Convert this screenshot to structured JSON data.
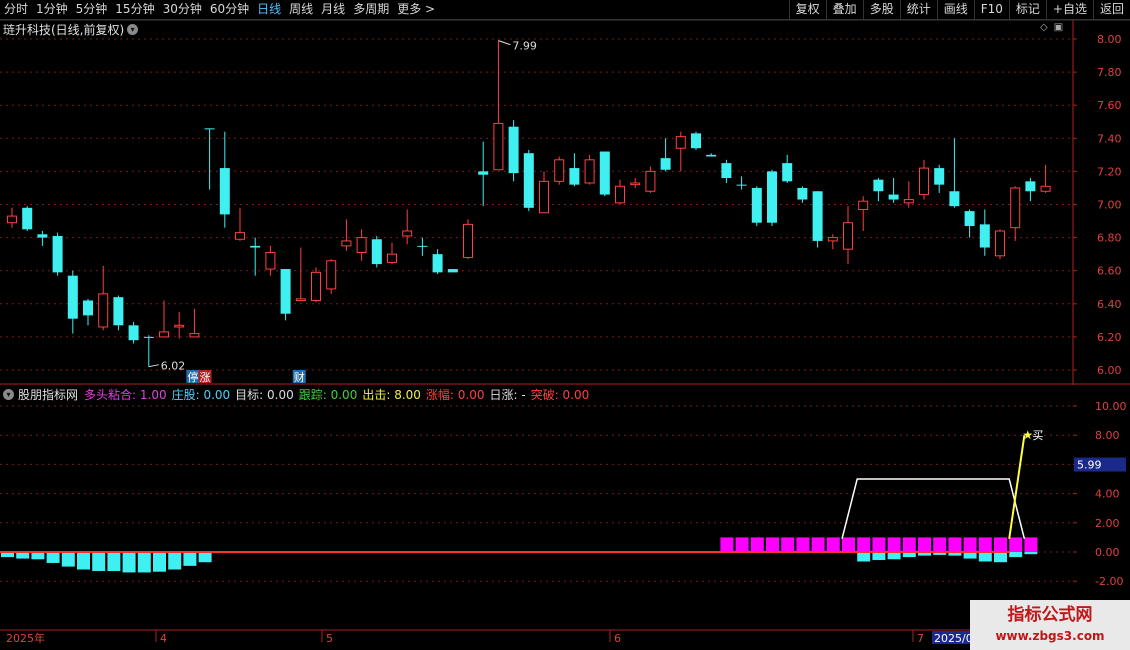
{
  "toolbar": {
    "periods": [
      "分时",
      "1分钟",
      "5分钟",
      "15分钟",
      "30分钟",
      "60分钟",
      "日线",
      "周线",
      "月线",
      "多周期",
      "更多 >"
    ],
    "active_period": "日线",
    "buttons": [
      "复权",
      "叠加",
      "多股",
      "统计",
      "画线",
      "F10",
      "标记",
      "+自选",
      "返回"
    ]
  },
  "main_panel": {
    "title": "琏升科技(日线,前复权)",
    "high_label": "7.99",
    "low_label": "6.02",
    "markers": [
      "停",
      "涨",
      "财"
    ],
    "y_ticks": [
      "8.00",
      "7.80",
      "7.60",
      "7.40",
      "7.20",
      "7.00",
      "6.80",
      "6.60",
      "6.40",
      "6.20",
      "6.00"
    ]
  },
  "indicator_panel": {
    "name": "股朋指标网",
    "items": [
      {
        "label": "多头粘合",
        "value": "1.00",
        "color": "#e040e0"
      },
      {
        "label": "庄股",
        "value": "0.00",
        "color": "#4fd0ff"
      },
      {
        "label": "目标",
        "value": "0.00",
        "color": "#dddddd"
      },
      {
        "label": "跟踪",
        "value": "0.00",
        "color": "#40d040"
      },
      {
        "label": "出击",
        "value": "8.00",
        "color": "#f0f040"
      },
      {
        "label": "涨幅",
        "value": "0.00",
        "color": "#ff4040"
      },
      {
        "label": "日涨",
        "value": "-",
        "color": "#dddddd"
      },
      {
        "label": "突破",
        "value": "0.00",
        "color": "#ff4040"
      }
    ],
    "y_ticks": [
      "10.00",
      "8.00",
      "6.00",
      "4.00",
      "2.00",
      "0.00",
      "-2.00"
    ],
    "current_value_box": "5.99",
    "buy_signal": "买"
  },
  "time_axis": {
    "labels": [
      "2025年",
      "4",
      "5",
      "6",
      "7",
      "2025/0"
    ]
  },
  "watermark": {
    "line1": "指标公式网",
    "line2": "www.zbgs3.com"
  },
  "colors": {
    "up": "#ff4040",
    "down": "#40f0f0",
    "grid": "#7a1a1a",
    "magenta": "#ff00ff",
    "yellow": "#ffff40"
  },
  "chart_data": {
    "type": "candlestick",
    "ylim": [
      5.95,
      8.05
    ],
    "high_label_value": 7.99,
    "low_label_value": 6.02,
    "candles": [
      {
        "o": 6.89,
        "c": 6.93,
        "h": 6.98,
        "l": 6.86
      },
      {
        "o": 6.98,
        "c": 6.85,
        "h": 6.99,
        "l": 6.84
      },
      {
        "o": 6.82,
        "c": 6.8,
        "h": 6.84,
        "l": 6.75
      },
      {
        "o": 6.81,
        "c": 6.59,
        "h": 6.83,
        "l": 6.57
      },
      {
        "o": 6.57,
        "c": 6.31,
        "h": 6.6,
        "l": 6.22
      },
      {
        "o": 6.42,
        "c": 6.33,
        "h": 6.43,
        "l": 6.27
      },
      {
        "o": 6.26,
        "c": 6.46,
        "h": 6.63,
        "l": 6.24
      },
      {
        "o": 6.44,
        "c": 6.27,
        "h": 6.45,
        "l": 6.24
      },
      {
        "o": 6.27,
        "c": 6.18,
        "h": 6.29,
        "l": 6.16
      },
      {
        "o": 6.2,
        "c": 6.2,
        "h": 6.21,
        "l": 6.02
      },
      {
        "o": 6.2,
        "c": 6.23,
        "h": 6.42,
        "l": 6.2
      },
      {
        "o": 6.26,
        "c": 6.27,
        "h": 6.35,
        "l": 6.19
      },
      {
        "o": 6.2,
        "c": 6.22,
        "h": 6.37,
        "l": 6.2
      },
      {
        "o": 7.46,
        "c": 7.46,
        "h": 7.46,
        "l": 7.09
      },
      {
        "o": 7.22,
        "c": 6.94,
        "h": 7.44,
        "l": 6.86
      },
      {
        "o": 6.79,
        "c": 6.83,
        "h": 6.98,
        "l": 6.78
      },
      {
        "o": 6.75,
        "c": 6.74,
        "h": 6.8,
        "l": 6.57
      },
      {
        "o": 6.61,
        "c": 6.71,
        "h": 6.75,
        "l": 6.57
      },
      {
        "o": 6.61,
        "c": 6.34,
        "h": 6.61,
        "l": 6.3
      },
      {
        "o": 6.42,
        "c": 6.43,
        "h": 6.74,
        "l": 6.42
      },
      {
        "o": 6.42,
        "c": 6.59,
        "h": 6.62,
        "l": 6.41
      },
      {
        "o": 6.49,
        "c": 6.66,
        "h": 6.67,
        "l": 6.46
      },
      {
        "o": 6.75,
        "c": 6.78,
        "h": 6.91,
        "l": 6.72
      },
      {
        "o": 6.71,
        "c": 6.8,
        "h": 6.85,
        "l": 6.66
      },
      {
        "o": 6.79,
        "c": 6.64,
        "h": 6.81,
        "l": 6.62
      },
      {
        "o": 6.65,
        "c": 6.7,
        "h": 6.77,
        "l": 6.64
      },
      {
        "o": 6.81,
        "c": 6.84,
        "h": 6.97,
        "l": 6.76
      },
      {
        "o": 6.75,
        "c": 6.75,
        "h": 6.8,
        "l": 6.69
      },
      {
        "o": 6.7,
        "c": 6.59,
        "h": 6.73,
        "l": 6.58
      },
      {
        "o": 6.61,
        "c": 6.59,
        "h": 6.61,
        "l": 6.59
      },
      {
        "o": 6.68,
        "c": 6.88,
        "h": 6.91,
        "l": 6.67
      },
      {
        "o": 7.2,
        "c": 7.18,
        "h": 7.38,
        "l": 6.99
      },
      {
        "o": 7.21,
        "c": 7.49,
        "h": 7.99,
        "l": 7.21
      },
      {
        "o": 7.47,
        "c": 7.19,
        "h": 7.51,
        "l": 7.14
      },
      {
        "o": 7.31,
        "c": 6.98,
        "h": 7.33,
        "l": 6.96
      },
      {
        "o": 6.95,
        "c": 7.14,
        "h": 7.2,
        "l": 6.95
      },
      {
        "o": 7.14,
        "c": 7.27,
        "h": 7.29,
        "l": 7.12
      },
      {
        "o": 7.22,
        "c": 7.12,
        "h": 7.31,
        "l": 7.11
      },
      {
        "o": 7.13,
        "c": 7.27,
        "h": 7.3,
        "l": 7.12
      },
      {
        "o": 7.32,
        "c": 7.06,
        "h": 7.32,
        "l": 7.05
      },
      {
        "o": 7.01,
        "c": 7.11,
        "h": 7.15,
        "l": 7.0
      },
      {
        "o": 7.12,
        "c": 7.13,
        "h": 7.16,
        "l": 7.1
      },
      {
        "o": 7.08,
        "c": 7.2,
        "h": 7.23,
        "l": 7.07
      },
      {
        "o": 7.28,
        "c": 7.21,
        "h": 7.4,
        "l": 7.2
      },
      {
        "o": 7.34,
        "c": 7.41,
        "h": 7.44,
        "l": 7.2
      },
      {
        "o": 7.43,
        "c": 7.34,
        "h": 7.44,
        "l": 7.33
      },
      {
        "o": 7.3,
        "c": 7.29,
        "h": 7.31,
        "l": 7.29
      },
      {
        "o": 7.25,
        "c": 7.16,
        "h": 7.27,
        "l": 7.13
      },
      {
        "o": 7.12,
        "c": 7.12,
        "h": 7.17,
        "l": 7.09
      },
      {
        "o": 7.1,
        "c": 6.89,
        "h": 7.11,
        "l": 6.87
      },
      {
        "o": 7.2,
        "c": 6.89,
        "h": 7.21,
        "l": 6.87
      },
      {
        "o": 7.25,
        "c": 7.14,
        "h": 7.3,
        "l": 7.13
      },
      {
        "o": 7.1,
        "c": 7.03,
        "h": 7.11,
        "l": 7.01
      },
      {
        "o": 7.08,
        "c": 6.78,
        "h": 7.08,
        "l": 6.74
      },
      {
        "o": 6.78,
        "c": 6.8,
        "h": 6.82,
        "l": 6.73
      },
      {
        "o": 6.73,
        "c": 6.89,
        "h": 6.99,
        "l": 6.64
      },
      {
        "o": 6.97,
        "c": 7.02,
        "h": 7.05,
        "l": 6.84
      },
      {
        "o": 7.15,
        "c": 7.08,
        "h": 7.16,
        "l": 7.02
      },
      {
        "o": 7.06,
        "c": 7.03,
        "h": 7.16,
        "l": 7.01
      },
      {
        "o": 7.01,
        "c": 7.03,
        "h": 7.14,
        "l": 6.98
      },
      {
        "o": 7.06,
        "c": 7.22,
        "h": 7.27,
        "l": 7.03
      },
      {
        "o": 7.22,
        "c": 7.12,
        "h": 7.24,
        "l": 7.07
      },
      {
        "o": 7.08,
        "c": 6.99,
        "h": 7.4,
        "l": 6.98
      },
      {
        "o": 6.96,
        "c": 6.87,
        "h": 6.97,
        "l": 6.8
      },
      {
        "o": 6.88,
        "c": 6.74,
        "h": 6.97,
        "l": 6.69
      },
      {
        "o": 6.69,
        "c": 6.84,
        "h": 6.85,
        "l": 6.67
      },
      {
        "o": 6.86,
        "c": 7.1,
        "h": 7.11,
        "l": 6.78
      },
      {
        "o": 7.14,
        "c": 7.08,
        "h": 7.16,
        "l": 7.02
      },
      {
        "o": 7.08,
        "c": 7.11,
        "h": 7.24,
        "l": 7.07
      }
    ],
    "indicator": {
      "ylim": [
        -3.0,
        11.0
      ],
      "cyan_bars": [
        -0.35,
        -0.45,
        -0.5,
        -0.75,
        -1.0,
        -1.2,
        -1.3,
        -1.3,
        -1.4,
        -1.4,
        -1.35,
        -1.2,
        -0.95,
        -0.7
      ],
      "magenta_bars_count": 21,
      "cyan_tail_bars": [
        -0.65,
        -0.55,
        -0.5,
        -0.35,
        -0.25,
        -0.2,
        -0.25,
        -0.45,
        -0.65,
        -0.7,
        -0.35,
        -0.15
      ],
      "white_line": [
        {
          "i": 55,
          "v": 0.9
        },
        {
          "i": 56,
          "v": 5.0
        },
        {
          "i": 66,
          "v": 5.0
        },
        {
          "i": 67,
          "v": 0.9
        }
      ],
      "yellow_line": [
        {
          "i": 66,
          "v": 0.9
        },
        {
          "i": 67,
          "v": 8.0
        }
      ],
      "zero_line": 0.0
    }
  }
}
